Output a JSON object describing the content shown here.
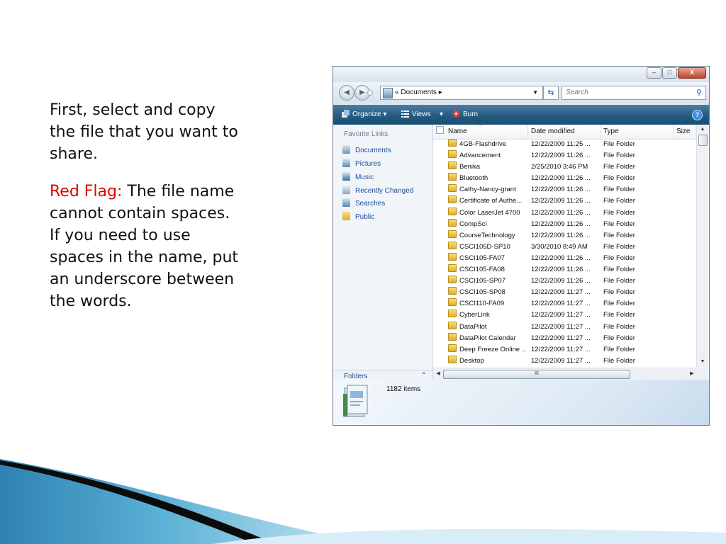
{
  "slide": {
    "para1": "First, select and copy the file that you want to share.",
    "red_flag_label": "Red Flag:",
    "para2_rest": " The file name cannot contain spaces. If you need to use spaces in the name, put an underscore between the words."
  },
  "window": {
    "caption": {
      "minimize": "–",
      "maximize": "□",
      "close": "X"
    },
    "address": {
      "chevrons": "«",
      "path": "Documents",
      "sep": "▸"
    },
    "search": {
      "placeholder": "Search"
    },
    "toolbar": {
      "organize": "Organize",
      "views": "Views",
      "burn": "Burn",
      "help": "?"
    },
    "nav": {
      "header": "Favorite Links",
      "items": [
        {
          "label": "Documents",
          "icon": "documents-icon"
        },
        {
          "label": "Pictures",
          "icon": "pictures-icon"
        },
        {
          "label": "Music",
          "icon": "music-icon"
        },
        {
          "label": "Recently Changed",
          "icon": "recently-changed-icon"
        },
        {
          "label": "Searches",
          "icon": "searches-icon"
        },
        {
          "label": "Public",
          "icon": "public-folder-icon"
        }
      ],
      "folders_label": "Folders"
    },
    "columns": {
      "name": "Name",
      "date": "Date modified",
      "type": "Type",
      "size": "Size"
    },
    "rows": [
      {
        "name": "4GB-Flashdrive",
        "date": "12/22/2009 11:25 ...",
        "type": "File Folder"
      },
      {
        "name": "Advancement",
        "date": "12/22/2009 11:26 ...",
        "type": "File Folder"
      },
      {
        "name": "Benika",
        "date": "2/25/2010 3:46 PM",
        "type": "File Folder"
      },
      {
        "name": "Bluetooth",
        "date": "12/22/2009 11:26 ...",
        "type": "File Folder"
      },
      {
        "name": "Cathy-Nancy-grant",
        "date": "12/22/2009 11:26 ...",
        "type": "File Folder"
      },
      {
        "name": "Certificate of Authe...",
        "date": "12/22/2009 11:26 ...",
        "type": "File Folder"
      },
      {
        "name": "Color LaserJet 4700",
        "date": "12/22/2009 11:26 ...",
        "type": "File Folder"
      },
      {
        "name": "CompSci",
        "date": "12/22/2009 11:26 ...",
        "type": "File Folder"
      },
      {
        "name": "CourseTechnology",
        "date": "12/22/2009 11:26 ...",
        "type": "File Folder"
      },
      {
        "name": "CSCI105D-SP10",
        "date": "3/30/2010 8:49 AM",
        "type": "File Folder"
      },
      {
        "name": "CSCI105-FA07",
        "date": "12/22/2009 11:26 ...",
        "type": "File Folder"
      },
      {
        "name": "CSCI105-FA08",
        "date": "12/22/2009 11:26 ...",
        "type": "File Folder"
      },
      {
        "name": "CSCI105-SP07",
        "date": "12/22/2009 11:26 ...",
        "type": "File Folder"
      },
      {
        "name": "CSCI105-SP08",
        "date": "12/22/2009 11:27 ...",
        "type": "File Folder"
      },
      {
        "name": "CSCI110-FA09",
        "date": "12/22/2009 11:27 ...",
        "type": "File Folder"
      },
      {
        "name": "CyberLink",
        "date": "12/22/2009 11:27 ...",
        "type": "File Folder"
      },
      {
        "name": "DataPilot",
        "date": "12/22/2009 11:27 ...",
        "type": "File Folder"
      },
      {
        "name": "DataPilot Calendar",
        "date": "12/22/2009 11:27 ...",
        "type": "File Folder"
      },
      {
        "name": "Deep Freeze Online ...",
        "date": "12/22/2009 11:27 ...",
        "type": "File Folder"
      },
      {
        "name": "Desktop",
        "date": "12/22/2009 11:27 ...",
        "type": "File Folder"
      }
    ],
    "hscroll_grip": "III",
    "status": {
      "count": "1182 items"
    }
  },
  "colors": {
    "red_flag": "#e00000",
    "toolbar": "#235a80",
    "link": "#1d4d9c"
  }
}
